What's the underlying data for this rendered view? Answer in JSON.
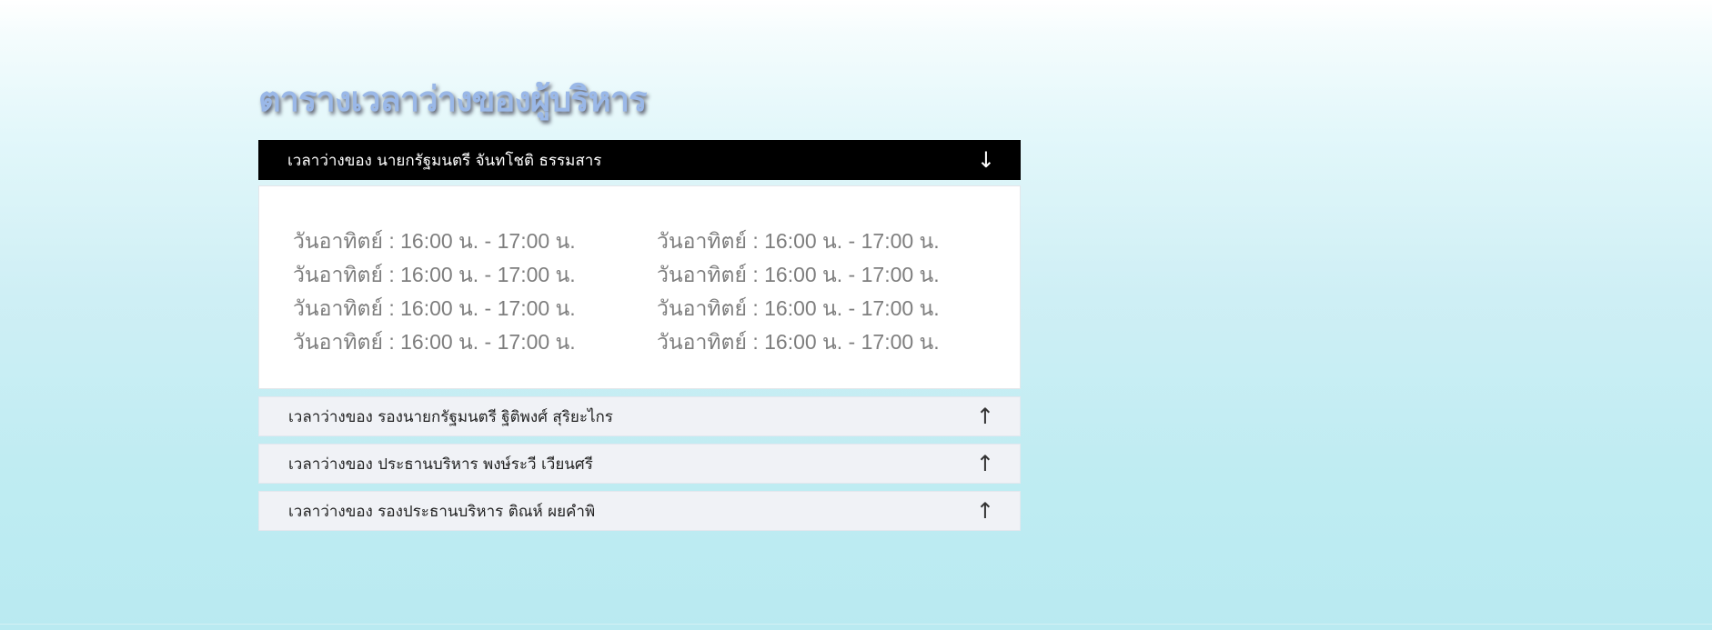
{
  "page": {
    "title": "ตารางเวลาว่างของผู้บริหาร"
  },
  "accordion": {
    "active": {
      "label": "เวลาว่างของ นายกรัฐมนตรี จันทโชติ ธรรมสาร",
      "icon": "arrow-down-icon",
      "icon_glyph": "↓",
      "schedule": [
        "วันอาทิตย์ : 16:00 น. - 17:00 น.",
        "วันอาทิตย์ : 16:00 น. - 17:00 น.",
        "วันอาทิตย์ : 16:00 น. - 17:00 น.",
        "วันอาทิตย์ : 16:00 น. - 17:00 น.",
        "วันอาทิตย์ : 16:00 น. - 17:00 น.",
        "วันอาทิตย์ : 16:00 น. - 17:00 น.",
        "วันอาทิตย์ : 16:00 น. - 17:00 น.",
        "วันอาทิตย์ : 16:00 น. - 17:00 น."
      ]
    },
    "collapsed": [
      {
        "label": "เวลาว่างของ รองนายกรัฐมนตรี ฐิติพงศ์ สุริยะไกร",
        "icon": "arrow-up-icon",
        "icon_glyph": "↑"
      },
      {
        "label": "เวลาว่างของ ประธานบริหาร พงษ์ระวี เวียนศรี",
        "icon": "arrow-up-icon",
        "icon_glyph": "↑"
      },
      {
        "label": "เวลาว่างของ รองประธานบริหาร ติณห์ ผยคำพิ",
        "icon": "arrow-up-icon",
        "icon_glyph": "↑"
      }
    ]
  },
  "colors": {
    "title": "#9ab8e8",
    "active_header_bg": "#000000",
    "collapsed_header_bg": "#f0f2f6",
    "schedule_text": "#7e7e7e"
  }
}
